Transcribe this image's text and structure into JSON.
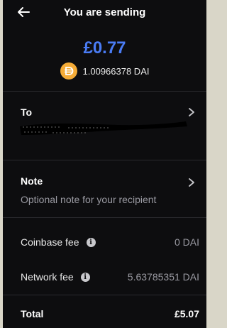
{
  "header": {
    "title": "You are sending",
    "back_icon": "back-arrow-icon"
  },
  "amount": {
    "fiat": "£0.77",
    "crypto": "1.00966378 DAI",
    "token_icon": "dai-icon",
    "accent_color": "#4a7cf5",
    "token_color": "#f5ac37"
  },
  "recipient": {
    "label": "To",
    "address": "[redacted]"
  },
  "note": {
    "label": "Note",
    "placeholder": "Optional note for your recipient"
  },
  "fees": [
    {
      "label": "Coinbase fee",
      "value": "0 DAI",
      "icon": "info-icon"
    },
    {
      "label": "Network fee",
      "value": "5.63785351 DAI",
      "icon": "info-icon"
    }
  ],
  "total": {
    "label": "Total",
    "value": "£5.07"
  }
}
